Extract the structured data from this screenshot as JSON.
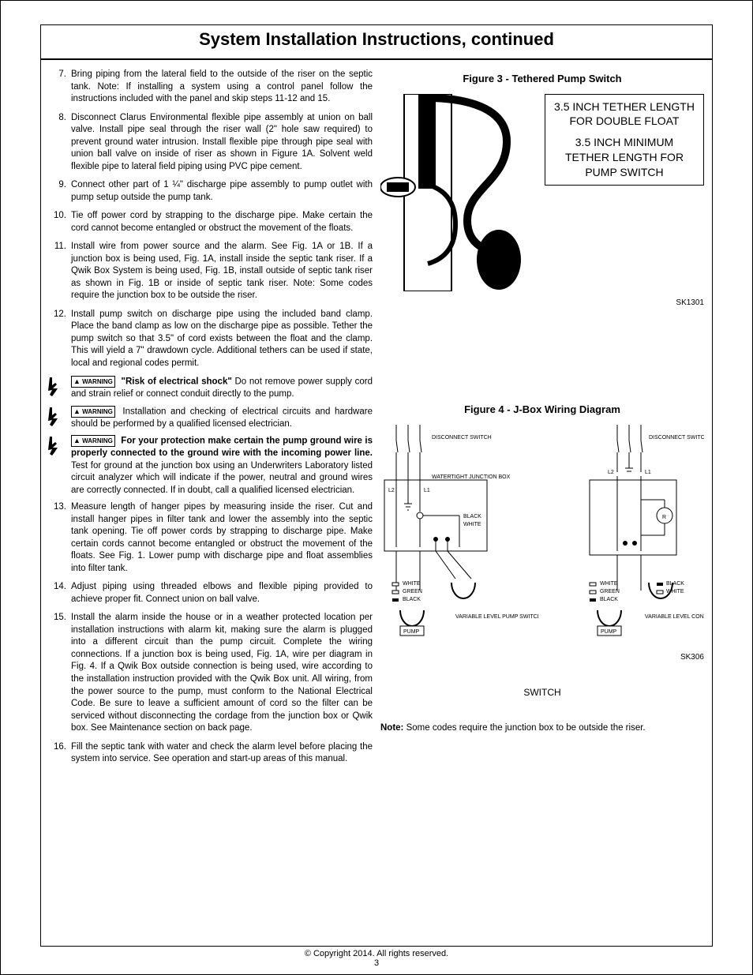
{
  "title": "System Installation Instructions, continued",
  "footer": {
    "copy": "© Copyright 2014. All rights reserved.",
    "page": "3"
  },
  "steps": [
    {
      "n": "7.",
      "t": "Bring piping from the lateral field to the outside of the riser on the septic tank. Note:  If installing a system using a control panel follow the instructions included with the panel and skip steps 11-12 and 15."
    },
    {
      "n": "8.",
      "t": "Disconnect Clarus Environmental flexible pipe assembly at union on ball valve.  Install pipe seal through the riser wall (2\" hole saw required) to prevent ground water intrusion.  Install flexible pipe through pipe seal with union ball valve on inside of riser as shown in Figure 1A. Solvent weld flexible pipe to lateral field piping using PVC pipe cement."
    },
    {
      "n": "9.",
      "t": "Connect other part of  1 ¼\" discharge pipe assembly to pump outlet with pump setup outside the pump tank."
    },
    {
      "n": "10.",
      "t": "Tie off power cord by strapping to the discharge pipe.  Make certain the cord cannot become entangled or obstruct the movement of the floats."
    },
    {
      "n": "11.",
      "t": "Install wire from power source and the alarm. See Fig. 1A or 1B. If a junction box is being used, Fig. 1A, install inside the septic tank riser. If a Qwik Box System is being used, Fig. 1B, install outside of septic tank riser as shown in Fig. 1B or inside of septic tank riser. Note: Some codes require the junction box to be outside the riser."
    },
    {
      "n": "12.",
      "t": "Install pump switch on discharge pipe using the included band clamp.  Place the band clamp as low on the discharge pipe as possible. Tether the pump switch so that 3.5\" of cord exists between the float and the clamp.  This will yield a 7\" drawdown cycle.  Additional tethers can be used if state, local and regional codes permit."
    }
  ],
  "warnings": {
    "w1_head": "\"Risk of electrical shock\"",
    "w1_body": "  Do not remove power supply cord and strain relief or connect conduit directly to the pump.",
    "w2": "Installation and checking of electrical circuits and hardware should be performed by a qualified licensed electrician.",
    "w3_head": "For your protection make certain the pump ground wire is properly connected to the ground wire with the incoming power line.",
    "w3_body": "  Test for ground at the junction box       using an Underwriters Laboratory listed circuit analyzer which will indicate if the power, neutral and ground wires are correctly connected. If in doubt, call a qualified licensed electrician.",
    "badge": "WARNING"
  },
  "steps2": [
    {
      "n": "13.",
      "t": "Measure length of hanger pipes by measuring inside the riser. Cut and install hanger pipes in filter tank and lower the assembly into the septic tank opening. Tie off power cords by strapping to discharge pipe. Make certain cords cannot become entangled or obstruct the movement of the floats. See Fig. 1. Lower pump with discharge pipe and float assemblies into filter tank."
    },
    {
      "n": "14.",
      "t": "Adjust piping using threaded elbows and flexible piping provided to achieve proper fit.  Connect union on ball valve."
    },
    {
      "n": "15.",
      "t": "Install the alarm inside the house or in a weather protected location per installation instructions with alarm kit, making sure the alarm is plugged into a different circuit than the pump circuit. Complete the wiring connections. If a junction box is being used, Fig. 1A, wire per diagram in Fig. 4. If a Qwik Box outside connection is being used, wire according to the installation instruction provided with the Qwik Box unit. All wiring, from the power source to the pump, must conform to the National Electrical Code. Be sure to leave a sufficient amount of cord so the filter can be serviced without disconnecting the cordage from the junction box or Qwik box. See Maintenance section on back page."
    },
    {
      "n": "16.",
      "t": "Fill the septic tank with water and check the alarm level before placing the system into service. See operation and start-up areas of this manual."
    }
  ],
  "fig3": {
    "title": "Figure 3 - Tethered Pump Switch",
    "label1": "3.5 INCH TETHER LENGTH FOR DOUBLE FLOAT",
    "label2": "3.5 INCH MINIMUM TETHER LENGTH FOR PUMP SWITCH",
    "sk": "SK1301"
  },
  "fig4": {
    "title": "Figure 4 - J-Box Wiring Diagram",
    "l": {
      "disconnect": "DISCONNECT SWITCH",
      "jbox": "WATERTIGHT JUNCTION BOX",
      "l2": "L2",
      "l1": "L1",
      "black": "BLACK",
      "white": "WHITE",
      "green": "GREEN",
      "pump": "PUMP",
      "vls": "VARIABLE LEVEL PUMP SWITCH"
    },
    "r": {
      "disconnect": "DISCONNECT SWITCH",
      "l2": "L2",
      "l1": "L1",
      "R": "R",
      "black": "BLACK",
      "white": "WHITE",
      "green": "GREEN",
      "pump": "PUMP",
      "vls": "VARIABLE LEVEL CONTROL SWITCH"
    },
    "sk": "SK306",
    "switch": "SWITCH",
    "note_b": "Note:",
    "note": " Some codes require the junction box to be outside the riser."
  }
}
